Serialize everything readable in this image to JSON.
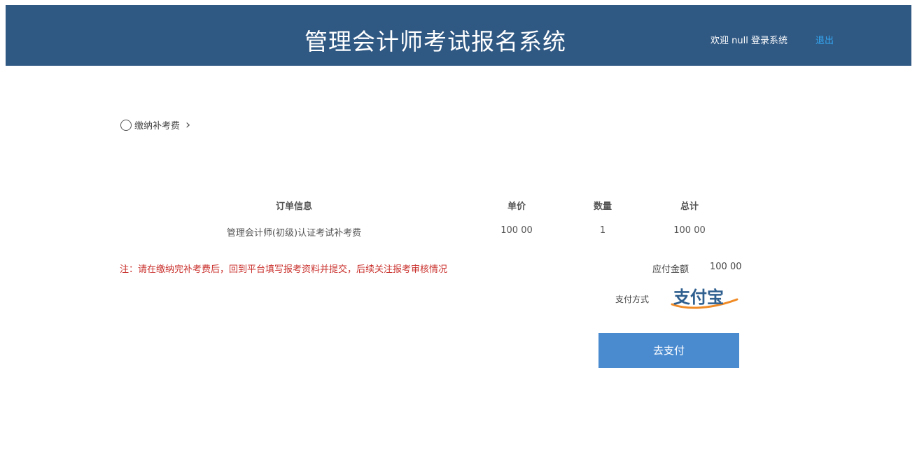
{
  "header": {
    "title": "管理会计师考试报名系统",
    "welcome": "欢迎 null 登录系统",
    "logout_label": "退出"
  },
  "step": {
    "label": "缴纳补考费",
    "arrow": "›"
  },
  "order_table": {
    "columns": [
      "订单信息",
      "单价",
      "数量",
      "总计"
    ],
    "rows": [
      [
        "管理会计师(初级)认证考试补考费",
        "100 00",
        "1",
        "100 00"
      ]
    ]
  },
  "note": "注：请在缴纳完补考费后，回到平台填写报考资料并提交，后续关注报考审核情况",
  "summary": {
    "due_label": "应付金额",
    "due_value": "100 00",
    "pay_method_label": "支付方式",
    "pay_method_logo": "支付宝"
  },
  "pay_button_label": "去支付",
  "colors": {
    "header_bg": "#2f5883",
    "logout_link": "#34a8f2",
    "note_text": "#c9302c",
    "pay_button": "#4a8bd0",
    "alipay_orange": "#f08a24",
    "alipay_text": "#2f5f8f"
  }
}
